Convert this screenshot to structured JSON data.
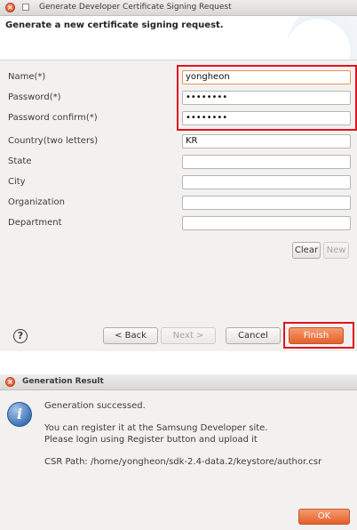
{
  "csr_dialog": {
    "title": "Generate Developer Certificate Signing Request",
    "banner_title": "Generate a new certificate signing request.",
    "fields": [
      {
        "label": "Name(*)",
        "value": "yongheon"
      },
      {
        "label": "Password(*)",
        "value": "••••••••"
      },
      {
        "label": "Password confirm(*)",
        "value": "••••••••"
      },
      {
        "label": "Country(two letters)",
        "value": "KR"
      },
      {
        "label": "State",
        "value": ""
      },
      {
        "label": "City",
        "value": ""
      },
      {
        "label": "Organization",
        "value": ""
      },
      {
        "label": "Department",
        "value": ""
      }
    ],
    "clear_label": "Clear",
    "new_label": "New",
    "help_glyph": "?",
    "back_label": "< Back",
    "next_label": "Next >",
    "cancel_label": "Cancel",
    "finish_label": "Finish"
  },
  "result_dialog": {
    "title": "Generation Result",
    "line1": "Generation successed.",
    "line2": "You can register it at the Samsung Developer site.",
    "line3": "Please login using Register button and upload it",
    "line4": "CSR Path: /home/yongheon/sdk-2.4-data.2/keystore/author.csr",
    "ok_label": "OK"
  },
  "icons": {
    "close": "close-icon",
    "maximize": "maximize-icon",
    "help": "help-icon",
    "info": "info-icon"
  },
  "colors": {
    "highlight_red": "#e0141e",
    "finish_orange": "#e4602a",
    "close_red": "#e2532b",
    "info_blue": "#3f74b8"
  }
}
